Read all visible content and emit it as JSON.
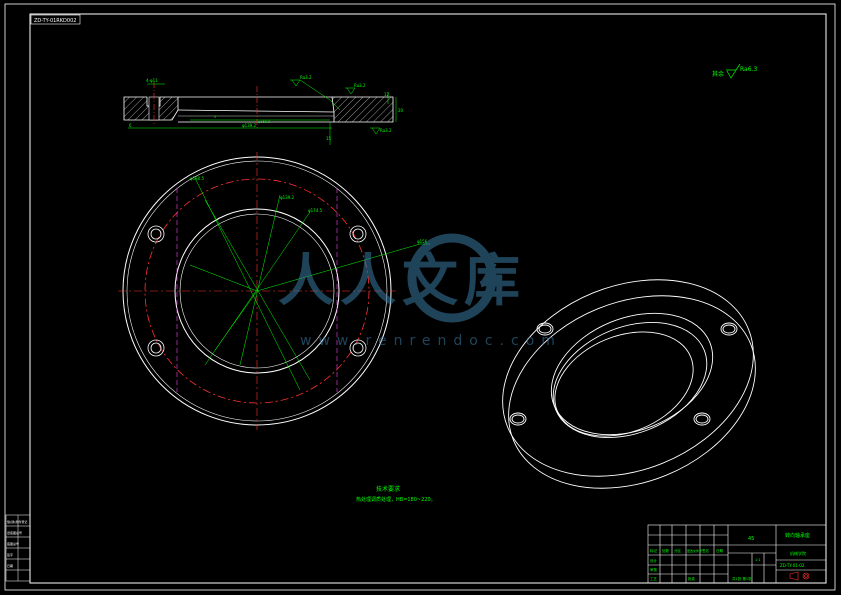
{
  "drawing_number_tag": "ZD-TY-01RKD002",
  "roughness_note": {
    "label": "其余",
    "value": "Ra6.3"
  },
  "tech_req": {
    "title": "技术要求",
    "line1": "热处理调质处理，HB=180~220。"
  },
  "watermark": {
    "brand": "人人文库",
    "url": "www.renrendoc.com"
  },
  "dims": {
    "d_hole": "4-φ11",
    "d_bore": "φ139.2",
    "d_outer": "φ180.5",
    "d_bolt": "φ174.5",
    "d_face": "φ160.3",
    "d_pcd": "φ156",
    "d_inner": "φ168",
    "d_mid": "φ140",
    "d_thick": "12",
    "d_sec1": "20",
    "d_sec2": "5",
    "d_chamfer": "6",
    "d_height": "15"
  },
  "roughness_marks": [
    "Ra3.2",
    "Ra3.2",
    "Ra3.2",
    "Ra6.3"
  ],
  "title_block": {
    "part_name": "转向轴承座",
    "material": "45",
    "drawing_no": "ZD-TY-01-02",
    "scale": "1:1",
    "school": "机械学院",
    "sheet": "共1张 第1张",
    "rows": [
      "标记",
      "处数",
      "分区",
      "更改文件号",
      "签名",
      "日期"
    ],
    "roles": [
      "设计",
      "审核",
      "工艺",
      "批准"
    ]
  },
  "side_block": [
    "借(通)用件登记",
    "旧底图总号",
    "底图总号",
    "签字",
    "日期"
  ]
}
